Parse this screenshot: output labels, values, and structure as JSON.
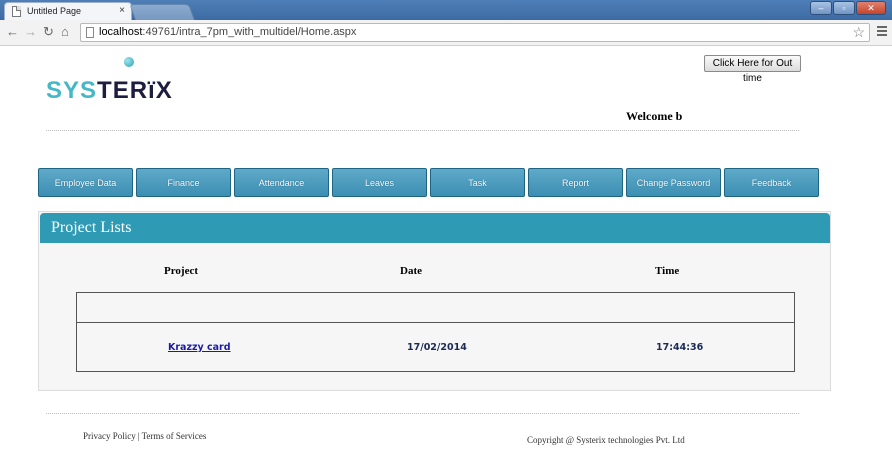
{
  "browser": {
    "tab_title": "Untitled Page",
    "tab_close": "×",
    "url_host": "localhost",
    "url_rest": ":49761/intra_7pm_with_multidel/Home.aspx",
    "win_min": "–",
    "win_max": "▫",
    "win_close": "✕"
  },
  "header": {
    "logo_part1": "SYS",
    "logo_part2": "TER",
    "logo_part3": "ïX",
    "out_time_label": "Click Here for Out time",
    "welcome_text": "Welcome b"
  },
  "nav": {
    "items": [
      "Employee  Data",
      "Finance",
      "Attendance",
      "Leaves",
      "Task",
      "Report",
      "Change Password",
      "Feedback"
    ]
  },
  "panel": {
    "title": "Project Lists",
    "columns": [
      "Project",
      "Date",
      "Time"
    ],
    "rows": [
      {
        "project": "Krazzy card",
        "date": "17/02/2014",
        "time": "17:44:36"
      }
    ]
  },
  "footer": {
    "privacy": "Privacy Policy",
    "separator": "|",
    "terms": "Terms of Services",
    "copyright": "Copyright @ Systerix technologies Pvt. Ltd"
  },
  "colors": {
    "accent": "#2f9ab3",
    "nav_button": "#4a9cbe",
    "logo_teal": "#45b8c8",
    "logo_dark": "#1d1d3f"
  }
}
